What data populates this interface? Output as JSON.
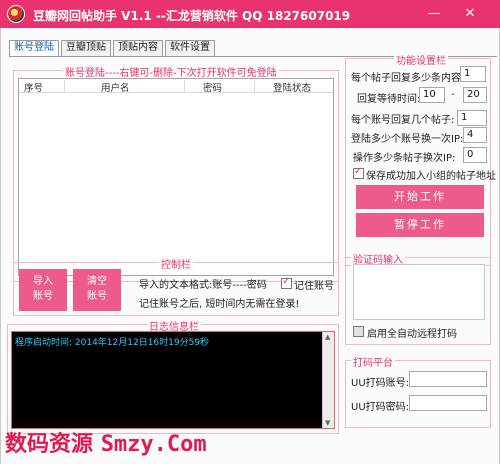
{
  "window": {
    "title": "豆瓣网回帖助手 V1.1 --汇龙营销软件  QQ 1827607019",
    "minimize_glyph": "—",
    "close_glyph": "✕"
  },
  "tabs": [
    {
      "label": "账号登陆"
    },
    {
      "label": "豆瓣顶贴"
    },
    {
      "label": "顶贴内容"
    },
    {
      "label": "软件设置"
    }
  ],
  "login": {
    "group_title": "账号登陆----右键可-删除-下次打开软件可免登陆",
    "columns": [
      "序号",
      "用户名",
      "密码",
      "登陆状态"
    ]
  },
  "control": {
    "group_title": "控制栏",
    "import_label": "导入账号",
    "clear_label": "清空账号",
    "format_text": "导入的文本格式:账号----密码",
    "remember_label": "记住账号",
    "remember_checked": true,
    "note_text": "记住账号之后, 短时间内无需在登录!"
  },
  "log": {
    "group_title": "日志信息栏",
    "lines": [
      "程序启动时间: 2014年12月12日16时19分59秒"
    ]
  },
  "settings": {
    "group_title": "功能设置栏",
    "replies_label": "每个帖子回复多少条内容:",
    "replies_value": "1",
    "interval_label": "回复等待时间:",
    "interval_from": "10",
    "interval_dash": "-",
    "interval_to": "20",
    "accounts_per_post_label": "每个账号回复几个帖子:",
    "accounts_per_post_value": "1",
    "switch_ip_label": "登陆多少个账号换一次IP:",
    "switch_ip_value": "4",
    "ops_switch_ip_label": "操作多少条帖子换次IP:",
    "ops_switch_ip_value": "0",
    "save_group_label": "保存成功加入小组的帖子地址",
    "save_group_checked": true,
    "start_label": "开始工作",
    "stop_label": "暂停工作"
  },
  "captcha": {
    "group_title": "验证码输入",
    "auto_remote_label": "启用全自动远程打码",
    "auto_remote_checked": false
  },
  "dama": {
    "group_title": "打码平台",
    "account_label": "UU打码账号:",
    "account_value": "",
    "password_label": "UU打码密码:",
    "password_value": ""
  },
  "watermark": {
    "cn": "数码资源",
    "en": "Smzy.Com"
  },
  "colors": {
    "accent": "#e8336c",
    "button": "#ec5b8a",
    "log_bg": "#000000",
    "log_text": "#33ccff"
  }
}
